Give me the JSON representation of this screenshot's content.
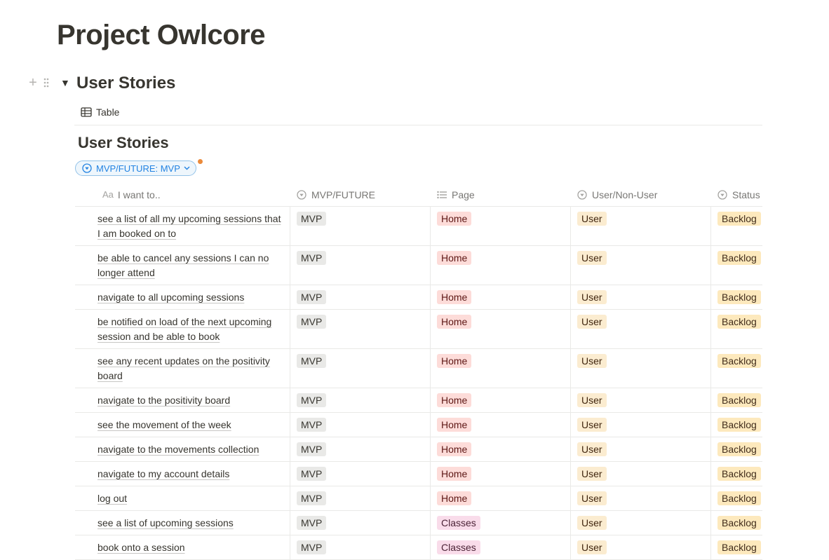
{
  "page": {
    "title": "Project Owlcore"
  },
  "toggle": {
    "heading": "User Stories"
  },
  "view": {
    "tab_label": "Table"
  },
  "database": {
    "title": "User Stories"
  },
  "filter": {
    "label": "MVP/FUTURE: MVP"
  },
  "columns": [
    {
      "label": "I want to..",
      "prefix": "Aa"
    },
    {
      "label": "MVP/FUTURE"
    },
    {
      "label": "Page"
    },
    {
      "label": "User/Non-User"
    },
    {
      "label": "Status"
    }
  ],
  "rows": [
    {
      "story": "see a list of all my upcoming sessions that I am booked on to",
      "mvp": "MVP",
      "page": "Home",
      "user": "User",
      "status": "Backlog"
    },
    {
      "story": "be able to cancel any sessions I can no longer attend",
      "mvp": "MVP",
      "page": "Home",
      "user": "User",
      "status": "Backlog"
    },
    {
      "story": "navigate to all upcoming sessions",
      "mvp": "MVP",
      "page": "Home",
      "user": "User",
      "status": "Backlog"
    },
    {
      "story": "be notified on load of the next upcoming session and be able to book",
      "mvp": "MVP",
      "page": "Home",
      "user": "User",
      "status": "Backlog"
    },
    {
      "story": "see any recent updates on the positivity board",
      "mvp": "MVP",
      "page": "Home",
      "user": "User",
      "status": "Backlog"
    },
    {
      "story": "navigate to the positivity board",
      "mvp": "MVP",
      "page": "Home",
      "user": "User",
      "status": "Backlog"
    },
    {
      "story": "see the movement of the week",
      "mvp": "MVP",
      "page": "Home",
      "user": "User",
      "status": "Backlog"
    },
    {
      "story": "navigate to the movements collection",
      "mvp": "MVP",
      "page": "Home",
      "user": "User",
      "status": "Backlog"
    },
    {
      "story": "navigate to my account details",
      "mvp": "MVP",
      "page": "Home",
      "user": "User",
      "status": "Backlog"
    },
    {
      "story": "log out",
      "mvp": "MVP",
      "page": "Home",
      "user": "User",
      "status": "Backlog"
    },
    {
      "story": "see a list of upcoming sessions",
      "mvp": "MVP",
      "page": "Classes",
      "user": "User",
      "status": "Backlog"
    },
    {
      "story": "book onto a session",
      "mvp": "MVP",
      "page": "Classes",
      "user": "User",
      "status": "Backlog"
    }
  ],
  "colors": {
    "accent": "#2383e2",
    "filter_dot": "#eb8a3b",
    "home_tag": "#fddcd9",
    "classes_tag": "#f9dcea",
    "user_tag": "#fbecd0",
    "backlog_tag": "#fde9bd",
    "mvp_tag": "#e9e9e7"
  }
}
